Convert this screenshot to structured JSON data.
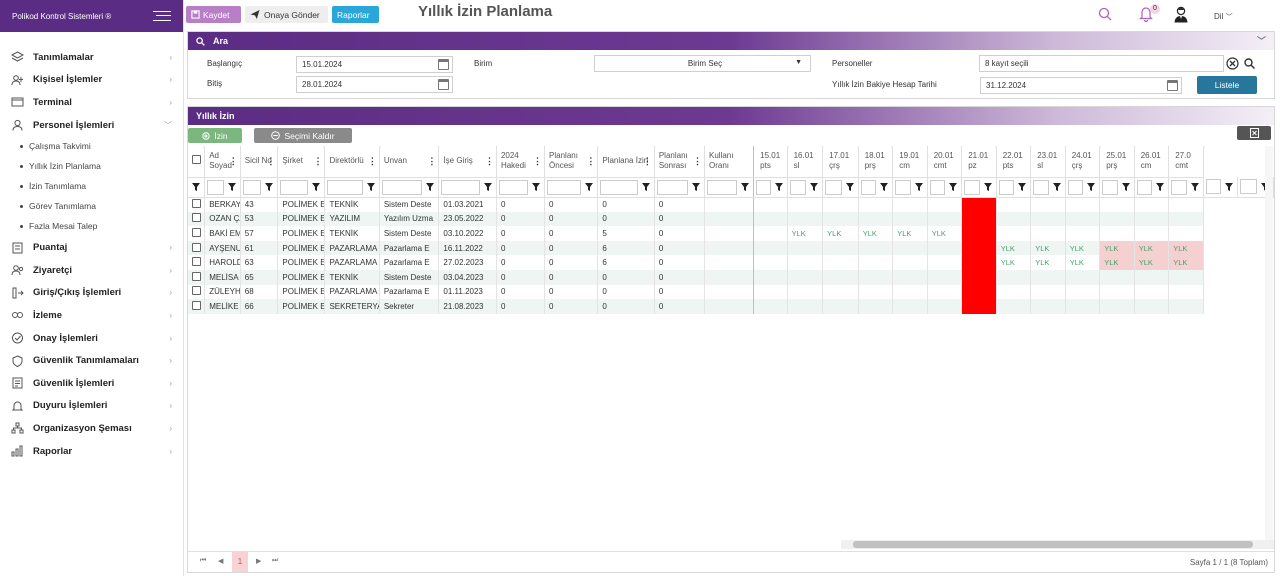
{
  "sidebar": {
    "brand": "Polikod Kontrol Sistemleri ®",
    "items": [
      {
        "label": "Tanımlamalar",
        "icon": "layers-icon"
      },
      {
        "label": "Kişisel İşlemler",
        "icon": "user-icon"
      },
      {
        "label": "Terminal",
        "icon": "terminal-icon"
      },
      {
        "label": "Personel İşlemleri",
        "icon": "person-icon"
      },
      {
        "label": "Puantaj",
        "icon": "puantaj-icon"
      },
      {
        "label": "Ziyaretçi",
        "icon": "visitor-icon"
      },
      {
        "label": "Giriş/Çıkış İşlemleri",
        "icon": "entry-exit-icon"
      },
      {
        "label": "İzleme",
        "icon": "monitor-icon"
      },
      {
        "label": "Onay İşlemleri",
        "icon": "check-circle-icon"
      },
      {
        "label": "Güvenlik Tanımlamaları",
        "icon": "shield-icon"
      },
      {
        "label": "Güvenlik İşlemleri",
        "icon": "security-list-icon"
      },
      {
        "label": "Duyuru İşlemleri",
        "icon": "bell-icon"
      },
      {
        "label": "Organizasyon Şeması",
        "icon": "org-chart-icon"
      },
      {
        "label": "Raporlar",
        "icon": "bar-chart-icon"
      }
    ],
    "subitems": [
      "Çalışma Takvimi",
      "Yıllık İzin Planlama",
      "İzin Tanımlama",
      "Görev Tanımlama",
      "Fazla Mesai Talep"
    ]
  },
  "topbar": {
    "save": "Kaydet",
    "send": "Onaya Gönder",
    "reports": "Raporlar",
    "title": "Yıllık İzin Planlama",
    "badge": "0",
    "lang": "Dil"
  },
  "search": {
    "title": "Ara",
    "start_label": "Başlangıç",
    "start_value": "15.01.2024",
    "end_label": "Bitiş",
    "end_value": "28.01.2024",
    "unit_label": "Birim",
    "unit_value": "Birim Seç",
    "personnel_label": "Personeller",
    "personnel_value": "8 kayıt seçili",
    "balance_label": "Yıllık İzin Bakiye Hesap Tarihi",
    "balance_value": "31.12.2024",
    "list_button": "Listele"
  },
  "grid": {
    "title": "Yıllık İzin",
    "izin_button": "İzin",
    "clear_button": "Seçimi Kaldır",
    "columns": [
      "Ad Soyad",
      "Sicil No",
      "Şirket",
      "Direktörlü",
      "Unvan",
      "İşe Giriş",
      "2024 Hakedi",
      "Planlanı Öncesi",
      "Planlana İzin",
      "Planlanı Sonrası",
      "Kullanı Oranı"
    ],
    "day_columns": [
      [
        "15.01",
        "pts"
      ],
      [
        "16.01",
        "sl"
      ],
      [
        "17.01",
        "çrş"
      ],
      [
        "18.01",
        "prş"
      ],
      [
        "19.01",
        "cm"
      ],
      [
        "20.01",
        "cmt"
      ],
      [
        "21.01",
        "pz"
      ],
      [
        "22.01",
        "pts"
      ],
      [
        "23.01",
        "sl"
      ],
      [
        "24.01",
        "çrş"
      ],
      [
        "25.01",
        "prş"
      ],
      [
        "26.01",
        "cm"
      ],
      [
        "27.0",
        "cmt"
      ]
    ],
    "rows": [
      {
        "name": "BERKAY ÖLMEZ",
        "sicil": "43",
        "company": "POLİMEK ELEKTRO",
        "dir": "TEKNİK",
        "title": "Sistem Deste",
        "start": "01.03.2021",
        "hak": "0",
        "pre": "0",
        "plan": "0",
        "post": "0",
        "rate": "",
        "days": [
          "",
          "",
          "",
          "",
          "",
          "",
          "",
          "",
          "",
          "",
          "",
          "",
          ""
        ]
      },
      {
        "name": "OZAN ÇAĞLAR ÖNDEYER",
        "sicil": "53",
        "company": "POLİMEK ELEKTRO",
        "dir": "YAZILIM",
        "title": "Yazılım Uzma",
        "start": "23.05.2022",
        "hak": "0",
        "pre": "0",
        "plan": "0",
        "post": "0",
        "rate": "",
        "days": [
          "",
          "",
          "",
          "",
          "",
          "",
          "",
          "",
          "",
          "",
          "",
          "",
          ""
        ]
      },
      {
        "name": "BAKİ EMRE BAKIR",
        "sicil": "57",
        "company": "POLİMEK ELEKTRO",
        "dir": "TEKNİK",
        "title": "Sistem Deste",
        "start": "03.10.2022",
        "hak": "0",
        "pre": "0",
        "plan": "5",
        "post": "0",
        "rate": "",
        "days": [
          "",
          "YLK",
          "YLK",
          "YLK",
          "YLK",
          "YLK",
          "",
          "",
          "",
          "",
          "",
          "",
          ""
        ]
      },
      {
        "name": "AYŞENUR AY",
        "sicil": "61",
        "company": "POLİMEK ELEKTRO",
        "dir": "PAZARLAMA",
        "title": "Pazarlama E",
        "start": "16.11.2022",
        "hak": "0",
        "pre": "0",
        "plan": "6",
        "post": "0",
        "rate": "",
        "days": [
          "",
          "",
          "",
          "",
          "",
          "",
          "",
          "YLK",
          "YLK",
          "YLK",
          "YLK",
          "YLK",
          "YLK"
        ]
      },
      {
        "name": "HAROLD HOUNSAVI",
        "sicil": "63",
        "company": "POLİMEK ELEKTRO",
        "dir": "PAZARLAMA",
        "title": "Pazarlama E",
        "start": "27.02.2023",
        "hak": "0",
        "pre": "0",
        "plan": "6",
        "post": "0",
        "rate": "",
        "days": [
          "",
          "",
          "",
          "",
          "",
          "",
          "",
          "YLK",
          "YLK",
          "YLK",
          "YLK",
          "YLK",
          "YLK"
        ]
      },
      {
        "name": "MELİSA ÖLMEZ",
        "sicil": "65",
        "company": "POLİMEK ELEKTRO",
        "dir": "TEKNİK",
        "title": "Sistem Deste",
        "start": "03.04.2023",
        "hak": "0",
        "pre": "0",
        "plan": "0",
        "post": "0",
        "rate": "",
        "days": [
          "",
          "",
          "",
          "",
          "",
          "",
          "",
          "",
          "",
          "",
          "",
          "",
          ""
        ]
      },
      {
        "name": "ZÜLEYHA ÖZ",
        "sicil": "68",
        "company": "POLİMEK ELEKTRO",
        "dir": "PAZARLAMA",
        "title": "Pazarlama E",
        "start": "01.11.2023",
        "hak": "0",
        "pre": "0",
        "plan": "0",
        "post": "0",
        "rate": "",
        "days": [
          "",
          "",
          "",
          "",
          "",
          "",
          "",
          "",
          "",
          "",
          "",
          "",
          ""
        ]
      },
      {
        "name": "MELİKE SAYGEL",
        "sicil": "66",
        "company": "POLİMEK ELEKTRO",
        "dir": "SEKRETERYA",
        "title": "Sekreter",
        "start": "21.08.2023",
        "hak": "0",
        "pre": "0",
        "plan": "0",
        "post": "0",
        "rate": "",
        "days": [
          "",
          "",
          "",
          "",
          "",
          "",
          "",
          "",
          "",
          "",
          "",
          "",
          ""
        ]
      }
    ],
    "holiday_col": 6,
    "pager": {
      "page": "1",
      "info": "Sayfa 1 / 1 (8 Toplam)"
    }
  },
  "colors": {
    "primary": "#5b2c83",
    "leave_text": "#45a06c",
    "holiday": "#ff0000",
    "weekend_leave": "#f5d0d0",
    "list_button": "#27769b"
  }
}
